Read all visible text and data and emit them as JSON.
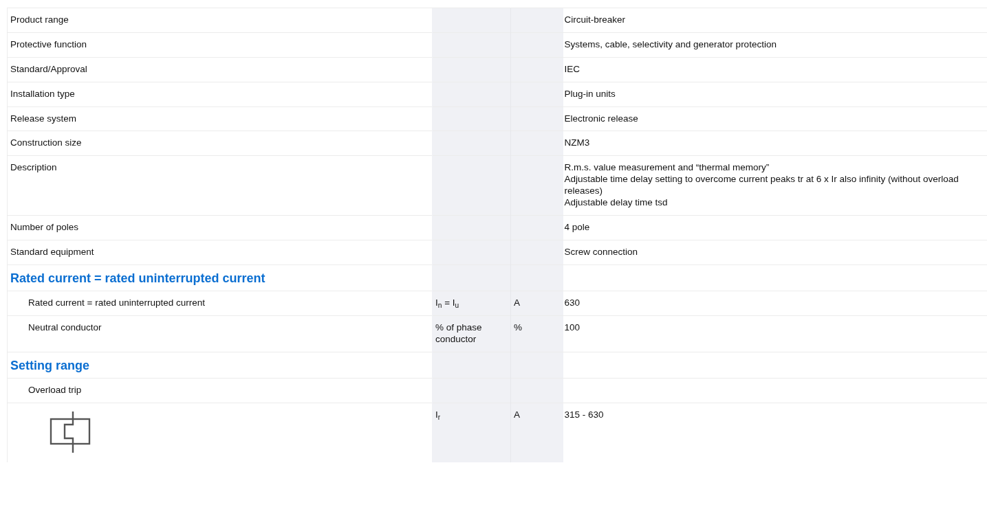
{
  "rows": [
    {
      "kind": "property",
      "label": "Product range",
      "value": [
        "Circuit-breaker"
      ]
    },
    {
      "kind": "property",
      "label": "Protective function",
      "value": [
        "Systems, cable, selectivity and generator protection"
      ]
    },
    {
      "kind": "property",
      "label": "Standard/Approval",
      "value": [
        "IEC"
      ]
    },
    {
      "kind": "property",
      "label": "Installation type",
      "value": [
        "Plug-in units"
      ]
    },
    {
      "kind": "property",
      "label": "Release system",
      "value": [
        "Electronic release"
      ]
    },
    {
      "kind": "property",
      "label": "Construction size",
      "value": [
        "NZM3"
      ]
    },
    {
      "kind": "property",
      "label": "Description",
      "value": [
        "R.m.s. value measurement and “thermal memory”",
        "Adjustable time delay setting to overcome current peaks tr at 6 x Ir also infinity (without overload releases)",
        "Adjustable delay time tsd"
      ]
    },
    {
      "kind": "property",
      "label": "Number of poles",
      "value": [
        "4 pole"
      ]
    },
    {
      "kind": "property",
      "label": "Standard equipment",
      "value": [
        "Screw connection"
      ]
    },
    {
      "kind": "section",
      "label": "Rated current = rated uninterrupted current"
    },
    {
      "kind": "subproperty",
      "label": "Rated current = rated uninterrupted current",
      "symbol": "I$_{n}$ = I$_{u}$",
      "unit": "A",
      "value": [
        "630"
      ]
    },
    {
      "kind": "subproperty",
      "label": "Neutral conductor",
      "symbol": "% of phase conductor",
      "unit": "%",
      "value": [
        "100"
      ]
    },
    {
      "kind": "section",
      "label": "Setting range"
    },
    {
      "kind": "subproperty",
      "label": "Overload trip"
    },
    {
      "kind": "symbol",
      "symbol": "I$_{r}$",
      "unit": "A",
      "value": [
        "315 - 630"
      ]
    }
  ]
}
